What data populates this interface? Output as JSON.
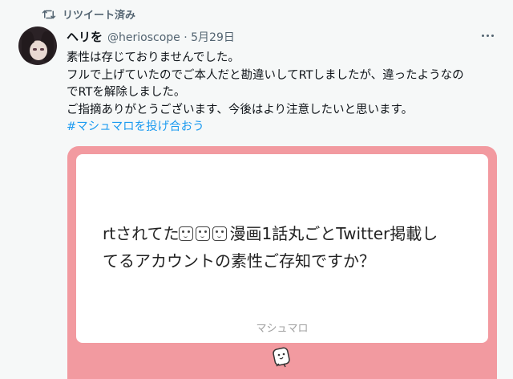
{
  "retweet": {
    "label": "リツイート済み",
    "icon": "retweet-icon"
  },
  "tweet": {
    "display_name": "ヘリを",
    "handle": "@herioscope",
    "separator": "·",
    "date": "5月29日",
    "lines": [
      "素性は存じておりませんでした。",
      "フルで上げていたのでご本人だと勘違いしてRTしましたが、違ったようなのでRTを解除しました。",
      "ご指摘ありがとうございます、今後はより注意したいと思います。"
    ],
    "line2a": "フルで上げていたのでご本人だと勘違いしてRTしましたが、違ったようなの",
    "line2b": "でRTを解除しました。",
    "hashtag": "#マシュマロを投げ合おう"
  },
  "card": {
    "question_prefix": "rtされてた",
    "question_suffix": "漫画1話丸ごとTwitter掲載し",
    "question_line2": "てるアカウントの素性ご存知ですか？",
    "brand": "マシュマロ",
    "colors": {
      "frame": "#f29aa0",
      "inner": "#ffffff"
    }
  },
  "colors": {
    "accent": "#1d9bf0",
    "muted": "#536471",
    "background": "#f6f8f8"
  }
}
